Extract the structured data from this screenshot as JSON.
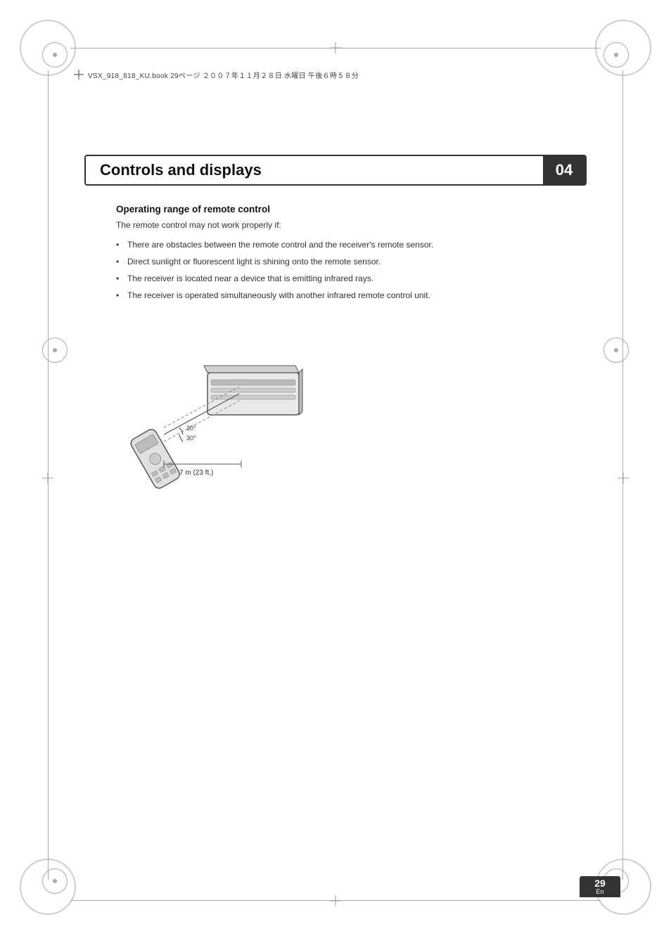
{
  "page": {
    "number": "29",
    "lang": "En",
    "chapter_number": "04",
    "header": {
      "text": "VSX_918_818_KU.book  29ページ  ２００７年１１月２８日  水曜日  午後６時５８分"
    },
    "section_title": "Controls and displays",
    "subsection_title": "Operating range of remote control",
    "intro_text": "The remote control may not work properly if:",
    "bullets": [
      "There are obstacles between the remote control and the receiver's remote sensor.",
      "Direct sunlight or fluorescent light is shining onto the remote sensor.",
      "The receiver is located near a device that is emitting infrared rays.",
      "The receiver is operated simultaneously with another infrared remote control unit."
    ],
    "diagram_label": "7 m (23 ft.)",
    "diagram_angle1": "30°",
    "diagram_angle2": "30°"
  }
}
